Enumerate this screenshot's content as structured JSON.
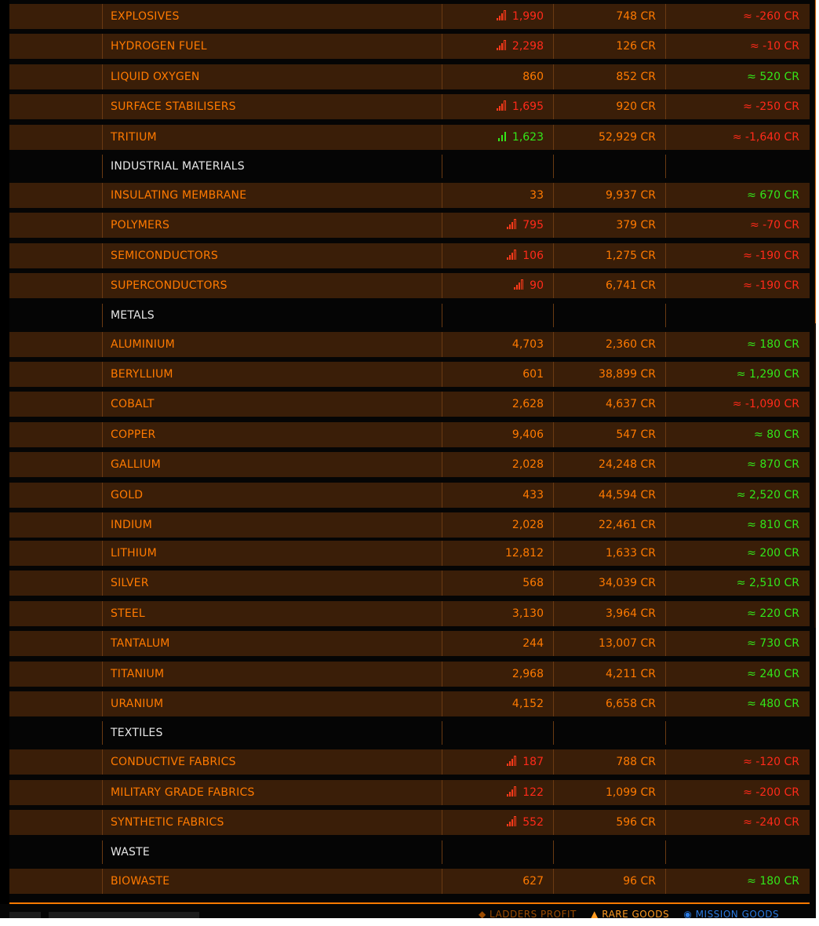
{
  "market": {
    "rows": [
      {
        "type": "item",
        "name": "EXPLOSIVES",
        "stock": "1,990",
        "stock_indicator": "red",
        "price": "748 CR",
        "diff": "≈ -260 CR",
        "diff_sign": "neg"
      },
      {
        "type": "item",
        "name": "HYDROGEN FUEL",
        "stock": "2,298",
        "stock_indicator": "red",
        "price": "126 CR",
        "diff": "≈ -10 CR",
        "diff_sign": "neg"
      },
      {
        "type": "item",
        "name": "LIQUID OXYGEN",
        "stock": "860",
        "stock_indicator": "none",
        "price": "852 CR",
        "diff": "≈ 520 CR",
        "diff_sign": "pos"
      },
      {
        "type": "item",
        "name": "SURFACE STABILISERS",
        "stock": "1,695",
        "stock_indicator": "red",
        "price": "920 CR",
        "diff": "≈ -250 CR",
        "diff_sign": "neg"
      },
      {
        "type": "item",
        "name": "TRITIUM",
        "stock": "1,623",
        "stock_indicator": "green",
        "price": "52,929 CR",
        "diff": "≈ -1,640 CR",
        "diff_sign": "neg"
      },
      {
        "type": "category",
        "name": "INDUSTRIAL MATERIALS"
      },
      {
        "type": "item",
        "name": "INSULATING MEMBRANE",
        "stock": "33",
        "stock_indicator": "none",
        "price": "9,937 CR",
        "diff": "≈ 670 CR",
        "diff_sign": "pos"
      },
      {
        "type": "item",
        "name": "POLYMERS",
        "stock": "795",
        "stock_indicator": "red",
        "price": "379 CR",
        "diff": "≈ -70 CR",
        "diff_sign": "neg"
      },
      {
        "type": "item",
        "name": "SEMICONDUCTORS",
        "stock": "106",
        "stock_indicator": "red",
        "price": "1,275 CR",
        "diff": "≈ -190 CR",
        "diff_sign": "neg"
      },
      {
        "type": "item",
        "name": "SUPERCONDUCTORS",
        "stock": "90",
        "stock_indicator": "red",
        "price": "6,741 CR",
        "diff": "≈ -190 CR",
        "diff_sign": "neg"
      },
      {
        "type": "category",
        "name": "METALS"
      },
      {
        "type": "item",
        "name": "ALUMINIUM",
        "stock": "4,703",
        "stock_indicator": "none",
        "price": "2,360 CR",
        "diff": "≈ 180 CR",
        "diff_sign": "pos"
      },
      {
        "type": "item",
        "name": "BERYLLIUM",
        "stock": "601",
        "stock_indicator": "none",
        "price": "38,899 CR",
        "diff": "≈ 1,290 CR",
        "diff_sign": "pos"
      },
      {
        "type": "item",
        "name": "COBALT",
        "stock": "2,628",
        "stock_indicator": "none",
        "price": "4,637 CR",
        "diff": "≈ -1,090 CR",
        "diff_sign": "neg"
      },
      {
        "type": "item",
        "name": "COPPER",
        "stock": "9,406",
        "stock_indicator": "none",
        "price": "547 CR",
        "diff": "≈ 80 CR",
        "diff_sign": "pos"
      },
      {
        "type": "item",
        "name": "GALLIUM",
        "stock": "2,028",
        "stock_indicator": "none",
        "price": "24,248 CR",
        "diff": "≈ 870 CR",
        "diff_sign": "pos"
      },
      {
        "type": "item",
        "name": "GOLD",
        "stock": "433",
        "stock_indicator": "none",
        "price": "44,594 CR",
        "diff": "≈ 2,520 CR",
        "diff_sign": "pos"
      },
      {
        "type": "item",
        "name": "INDIUM",
        "stock": "2,028",
        "stock_indicator": "none",
        "price": "22,461 CR",
        "diff": "≈ 810 CR",
        "diff_sign": "pos"
      },
      {
        "type": "item",
        "name": "LITHIUM",
        "stock": "12,812",
        "stock_indicator": "none",
        "price": "1,633 CR",
        "diff": "≈ 200 CR",
        "diff_sign": "pos"
      },
      {
        "type": "item",
        "name": "SILVER",
        "stock": "568",
        "stock_indicator": "none",
        "price": "34,039 CR",
        "diff": "≈ 2,510 CR",
        "diff_sign": "pos"
      },
      {
        "type": "item",
        "name": "STEEL",
        "stock": "3,130",
        "stock_indicator": "none",
        "price": "3,964 CR",
        "diff": "≈ 220 CR",
        "diff_sign": "pos"
      },
      {
        "type": "item",
        "name": "TANTALUM",
        "stock": "244",
        "stock_indicator": "none",
        "price": "13,007 CR",
        "diff": "≈ 730 CR",
        "diff_sign": "pos"
      },
      {
        "type": "item",
        "name": "TITANIUM",
        "stock": "2,968",
        "stock_indicator": "none",
        "price": "4,211 CR",
        "diff": "≈ 240 CR",
        "diff_sign": "pos"
      },
      {
        "type": "item",
        "name": "URANIUM",
        "stock": "4,152",
        "stock_indicator": "none",
        "price": "6,658 CR",
        "diff": "≈ 480 CR",
        "diff_sign": "pos"
      },
      {
        "type": "category",
        "name": "TEXTILES"
      },
      {
        "type": "item",
        "name": "CONDUCTIVE FABRICS",
        "stock": "187",
        "stock_indicator": "red",
        "price": "788 CR",
        "diff": "≈ -120 CR",
        "diff_sign": "neg"
      },
      {
        "type": "item",
        "name": "MILITARY GRADE FABRICS",
        "stock": "122",
        "stock_indicator": "red",
        "price": "1,099 CR",
        "diff": "≈ -200 CR",
        "diff_sign": "neg"
      },
      {
        "type": "item",
        "name": "SYNTHETIC FABRICS",
        "stock": "552",
        "stock_indicator": "red",
        "price": "596 CR",
        "diff": "≈ -240 CR",
        "diff_sign": "neg"
      },
      {
        "type": "category",
        "name": "WASTE"
      },
      {
        "type": "item",
        "name": "BIOWASTE",
        "stock": "627",
        "stock_indicator": "none",
        "price": "96 CR",
        "diff": "≈ 180 CR",
        "diff_sign": "pos"
      }
    ]
  },
  "footer": {
    "legend_1": "◆ LADDERS PROFIT",
    "legend_2": "▲ RARE GOODS",
    "legend_3": "◉ MISSION GOODS"
  },
  "colors": {
    "accent": "#ff7a00",
    "row_bg": "#3a1e08",
    "positive": "#33e61a",
    "negative": "#ff2a1a",
    "category_text": "#e6e6e6"
  },
  "icons": {
    "supply_bars_red": "signal-bars-low-icon",
    "supply_bars_green": "signal-bars-high-icon"
  }
}
